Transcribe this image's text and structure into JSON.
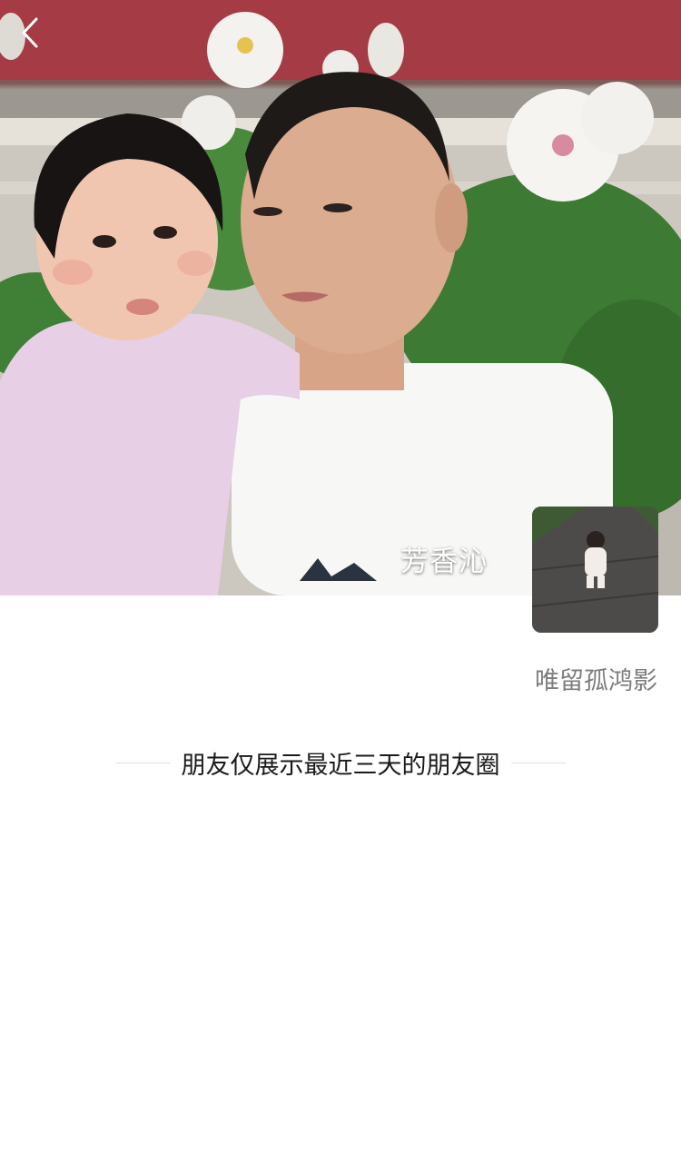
{
  "header": {
    "back_icon": "chevron-left-icon"
  },
  "cover": {
    "name": "芳香沁",
    "image": "cover-photo"
  },
  "profile": {
    "avatar": "avatar-image",
    "signature": "唯留孤鸿影"
  },
  "notice": {
    "text": "朋友仅展示最近三天的朋友圈"
  },
  "colors": {
    "wall_red": "#a63d45",
    "text_primary": "#1a1a1a",
    "text_secondary": "#7d7d7d",
    "divider": "#e0e0e0"
  }
}
